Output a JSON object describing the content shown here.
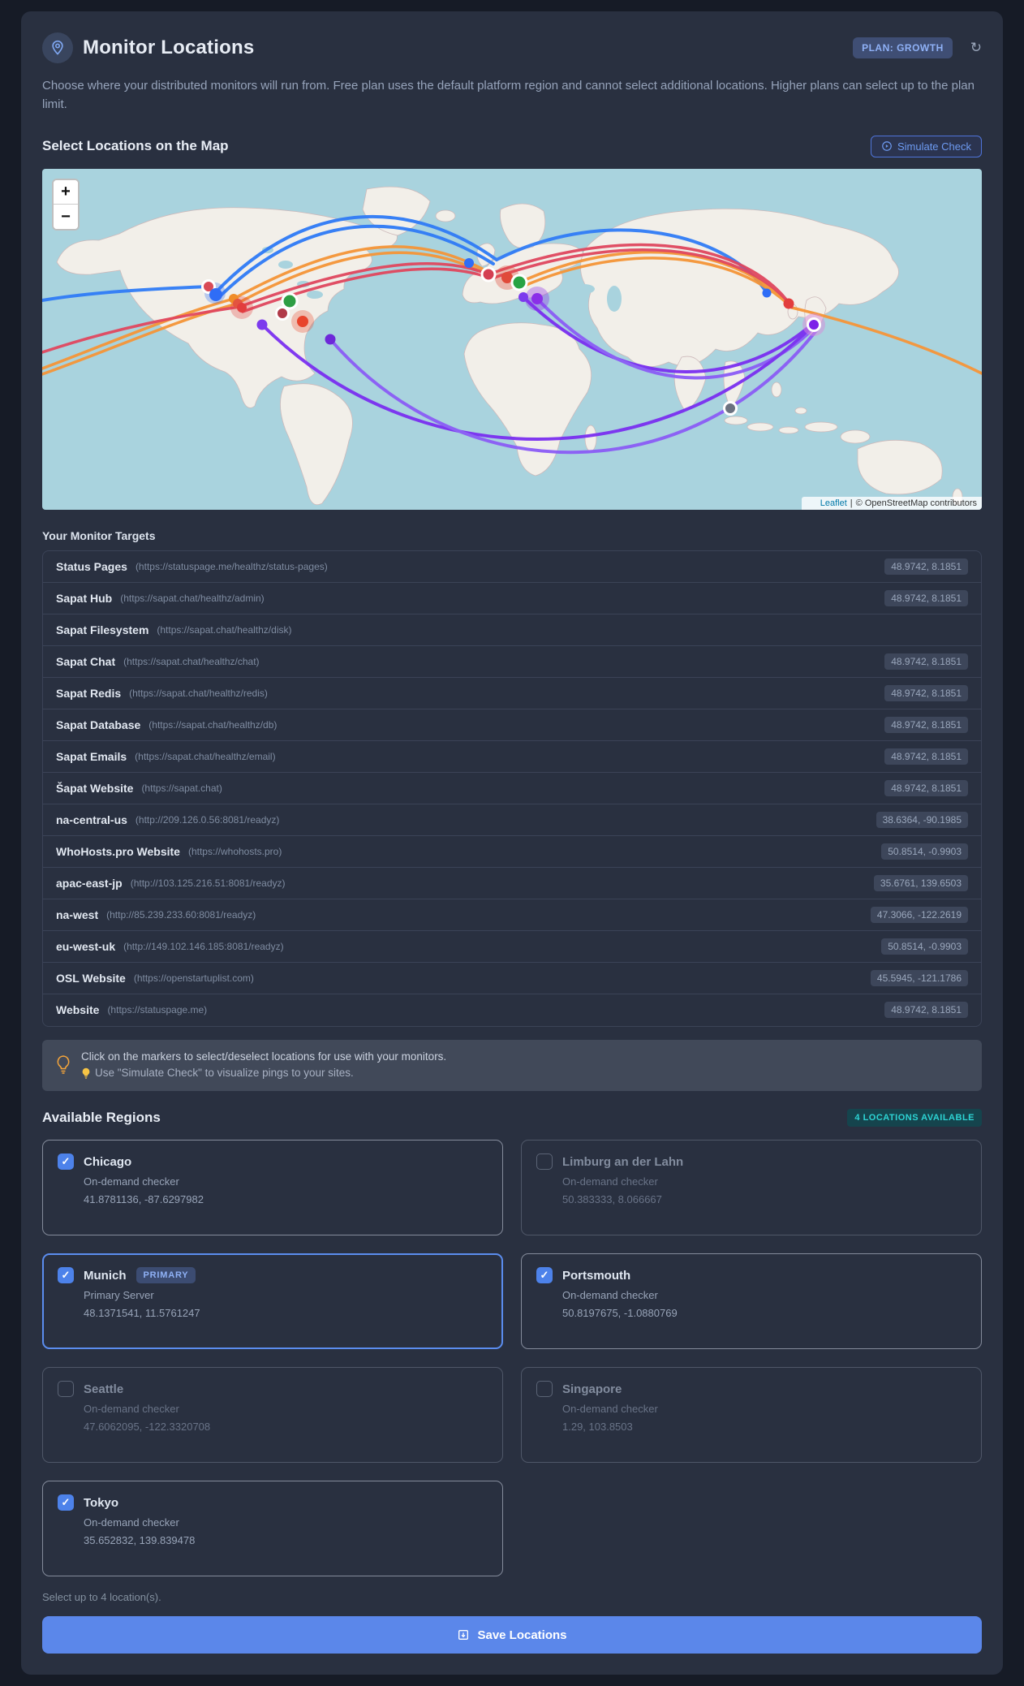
{
  "header": {
    "title": "Monitor Locations",
    "plan_badge": "PLAN: GROWTH",
    "description": "Choose where your distributed monitors will run from. Free plan uses the default platform region and cannot select additional locations. Higher plans can select up to the plan limit."
  },
  "map_section": {
    "heading": "Select Locations on the Map",
    "simulate_button": "Simulate Check",
    "zoom_in": "+",
    "zoom_out": "−",
    "attribution": {
      "leaflet": "Leaflet",
      "separator": "|",
      "osm": "© OpenStreetMap contributors"
    }
  },
  "targets": {
    "heading": "Your Monitor Targets",
    "rows": [
      {
        "name": "Status Pages",
        "url": "https://statuspage.me/healthz/status-pages",
        "coords": "48.9742, 8.1851"
      },
      {
        "name": "Sapat Hub",
        "url": "https://sapat.chat/healthz/admin",
        "coords": "48.9742, 8.1851"
      },
      {
        "name": "Sapat Filesystem",
        "url": "https://sapat.chat/healthz/disk",
        "coords": ""
      },
      {
        "name": "Sapat Chat",
        "url": "https://sapat.chat/healthz/chat",
        "coords": "48.9742, 8.1851"
      },
      {
        "name": "Sapat Redis",
        "url": "https://sapat.chat/healthz/redis",
        "coords": "48.9742, 8.1851"
      },
      {
        "name": "Sapat Database",
        "url": "https://sapat.chat/healthz/db",
        "coords": "48.9742, 8.1851"
      },
      {
        "name": "Sapat Emails",
        "url": "https://sapat.chat/healthz/email",
        "coords": "48.9742, 8.1851"
      },
      {
        "name": "Šapat Website",
        "url": "https://sapat.chat",
        "coords": "48.9742, 8.1851"
      },
      {
        "name": "na-central-us",
        "url": "http://209.126.0.56:8081/readyz",
        "coords": "38.6364, -90.1985"
      },
      {
        "name": "WhoHosts.pro Website",
        "url": "https://whohosts.pro",
        "coords": "50.8514, -0.9903"
      },
      {
        "name": "apac-east-jp",
        "url": "http://103.125.216.51:8081/readyz",
        "coords": "35.6761, 139.6503"
      },
      {
        "name": "na-west",
        "url": "http://85.239.233.60:8081/readyz",
        "coords": "47.3066, -122.2619"
      },
      {
        "name": "eu-west-uk",
        "url": "http://149.102.146.185:8081/readyz",
        "coords": "50.8514, -0.9903"
      },
      {
        "name": "OSL Website",
        "url": "https://openstartuplist.com",
        "coords": "45.5945, -121.1786"
      },
      {
        "name": "Website",
        "url": "https://statuspage.me",
        "coords": "48.9742, 8.1851"
      }
    ]
  },
  "tip": {
    "line1": "Click on the markers to select/deselect locations for use with your monitors.",
    "line2": "Use \"Simulate Check\" to visualize pings to your sites."
  },
  "regions": {
    "heading": "Available Regions",
    "badge": "4 LOCATIONS AVAILABLE",
    "footer_note": "Select up to 4 location(s).",
    "cards": [
      {
        "name": "Chicago",
        "subtitle": "On-demand checker",
        "coords": "41.8781136, -87.6297982",
        "checked": true,
        "primary": false,
        "disabled": false,
        "primary_badge": ""
      },
      {
        "name": "Limburg an der Lahn",
        "subtitle": "On-demand checker",
        "coords": "50.383333, 8.066667",
        "checked": false,
        "primary": false,
        "disabled": true,
        "primary_badge": ""
      },
      {
        "name": "Munich",
        "subtitle": "Primary Server",
        "coords": "48.1371541, 11.5761247",
        "checked": true,
        "primary": true,
        "disabled": false,
        "primary_badge": "PRIMARY"
      },
      {
        "name": "Portsmouth",
        "subtitle": "On-demand checker",
        "coords": "50.8197675, -1.0880769",
        "checked": true,
        "primary": false,
        "disabled": false,
        "primary_badge": ""
      },
      {
        "name": "Seattle",
        "subtitle": "On-demand checker",
        "coords": "47.6062095, -122.3320708",
        "checked": false,
        "primary": false,
        "disabled": true,
        "primary_badge": ""
      },
      {
        "name": "Singapore",
        "subtitle": "On-demand checker",
        "coords": "1.29, 103.8503",
        "checked": false,
        "primary": false,
        "disabled": true,
        "primary_badge": ""
      },
      {
        "name": "Tokyo",
        "subtitle": "On-demand checker",
        "coords": "35.652832, 139.839478",
        "checked": true,
        "primary": false,
        "disabled": false,
        "primary_badge": ""
      }
    ]
  },
  "save": {
    "label": "Save Locations"
  },
  "colors": {
    "accent_blue": "#5b87ea",
    "cyan": "#2dd4d4",
    "map_ocean": "#a9d3de",
    "map_land": "#f2efe9",
    "arc_blue": "#2f7bf6",
    "arc_orange": "#f59538",
    "arc_crimson": "#e0475e",
    "arc_purple": "#7a2ff0"
  }
}
